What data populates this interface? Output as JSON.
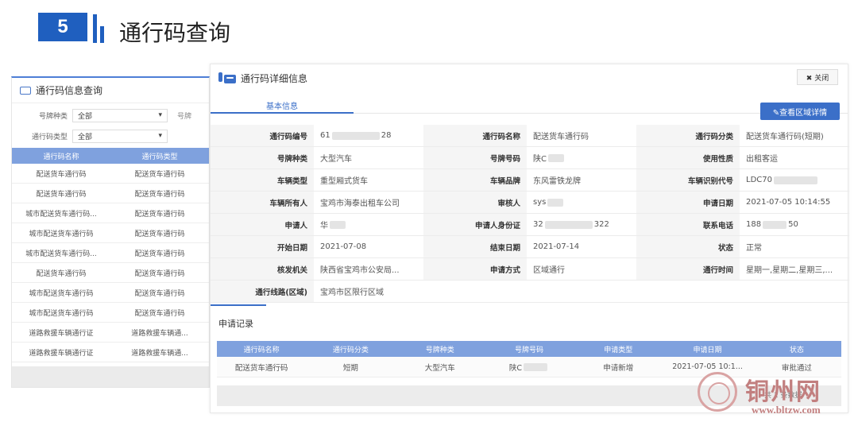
{
  "slide": {
    "number": "5",
    "title": "通行码查询"
  },
  "left_panel": {
    "title": "通行码信息查询",
    "filters": [
      {
        "label": "号牌种类",
        "value": "全部",
        "extra": "号牌"
      },
      {
        "label": "通行码类型",
        "value": "全部",
        "extra": ""
      }
    ],
    "columns": [
      "通行码名称",
      "通行码类型"
    ],
    "rows": [
      [
        "配送货车通行码",
        "配送货车通行码"
      ],
      [
        "配送货车通行码",
        "配送货车通行码"
      ],
      [
        "城市配送货车通行码...",
        "配送货车通行码"
      ],
      [
        "城市配送货车通行码",
        "配送货车通行码"
      ],
      [
        "城市配送货车通行码...",
        "配送货车通行码"
      ],
      [
        "配送货车通行码",
        "配送货车通行码"
      ],
      [
        "城市配送货车通行码",
        "配送货车通行码"
      ],
      [
        "城市配送货车通行码",
        "配送货车通行码"
      ],
      [
        "道路救援车辆通行证",
        "道路救援车辆通..."
      ],
      [
        "道路救援车辆通行证",
        "道路救援车辆通..."
      ]
    ]
  },
  "detail_panel": {
    "title": "通行码详细信息",
    "close_label": "✖ 关闭",
    "tab_label": "基本信息",
    "region_button": "✎查看区域详情",
    "fields": [
      [
        [
          "通行码编号",
          "61",
          "28"
        ],
        [
          "通行码名称",
          "配送货车通行码",
          ""
        ],
        [
          "通行码分类",
          "配送货车通行码(短期)",
          ""
        ]
      ],
      [
        [
          "号牌种类",
          "大型汽车",
          ""
        ],
        [
          "号牌号码",
          "陕C",
          ""
        ],
        [
          "使用性质",
          "出租客运",
          ""
        ]
      ],
      [
        [
          "车辆类型",
          "重型厢式货车",
          ""
        ],
        [
          "车辆品牌",
          "东风雷铁龙牌",
          ""
        ],
        [
          "车辆识别代号",
          "LDC70",
          ""
        ]
      ],
      [
        [
          "车辆所有人",
          "宝鸡市海泰出租车公司",
          ""
        ],
        [
          "审核人",
          "sys",
          ""
        ],
        [
          "申请日期",
          "2021-07-05 10:14:55",
          ""
        ]
      ],
      [
        [
          "申请人",
          "华",
          ""
        ],
        [
          "申请人身份证",
          "32",
          "322"
        ],
        [
          "联系电话",
          "188",
          "50"
        ]
      ],
      [
        [
          "开始日期",
          "2021-07-08",
          ""
        ],
        [
          "结束日期",
          "2021-07-14",
          ""
        ],
        [
          "状态",
          "正常",
          ""
        ]
      ],
      [
        [
          "核发机关",
          "陕西省宝鸡市公安局...",
          ""
        ],
        [
          "申请方式",
          "区域通行",
          ""
        ],
        [
          "通行时间",
          "星期一,星期二,星期三,...",
          ""
        ]
      ],
      [
        [
          "通行线路(区域)",
          "宝鸡市区限行区域",
          ""
        ]
      ]
    ],
    "records_title": "申请记录",
    "record_columns": [
      "通行码名称",
      "通行码分类",
      "号牌种类",
      "号牌号码",
      "申请类型",
      "申请日期",
      "状态"
    ],
    "record_rows": [
      [
        "配送货车通行码",
        "短期",
        "大型汽车",
        "陕C",
        "申请新增",
        "2021-07-05 10:1...",
        "审批通过"
      ]
    ]
  },
  "watermark": {
    "text": "铜州网",
    "url": "www.bltzw.com",
    "sub": "共 1 条数据"
  }
}
